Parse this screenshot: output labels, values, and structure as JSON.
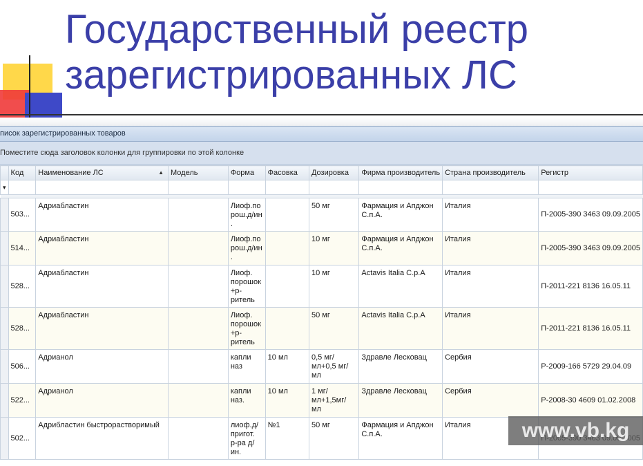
{
  "slide": {
    "title_line1": "Государственный реестр",
    "title_line2": "зарегистрированных ЛС"
  },
  "window": {
    "title": "писок зарегистрированных товаров",
    "group_hint": "Поместите сюда заголовок колонки для группировки по этой колонке"
  },
  "columns": [
    "Код",
    "Наименование ЛС",
    "Модель",
    "Форма",
    "Фасовка",
    "Дозировка",
    "Фирма производитель",
    "Страна производитель",
    "Регистр"
  ],
  "rows": [
    {
      "code": "503...",
      "name": "Адриабластин",
      "model": "",
      "form": "Лиоф.по рош.д/ин .",
      "pack": "",
      "dose": "50 мг",
      "maker": "Фармация и Апджон С.п.А.",
      "country": "Италия",
      "reg": "П-2005-390 3463 09.09.2005"
    },
    {
      "code": "514...",
      "name": "Адриабластин",
      "model": "",
      "form": "Лиоф.по рош.д/ин .",
      "pack": "",
      "dose": "10 мг",
      "maker": "Фармация и Апджон С.п.А.",
      "country": "Италия",
      "reg": "П-2005-390 3463 09.09.2005"
    },
    {
      "code": "528...",
      "name": "Адриабластин",
      "model": "",
      "form": "Лиоф. порошок +р-ритель",
      "pack": "",
      "dose": "10 мг",
      "maker": "Actavis Italia C.p.A",
      "country": "Италия",
      "reg": "П-2011-221 8136 16.05.11"
    },
    {
      "code": "528...",
      "name": "Адриабластин",
      "model": "",
      "form": "Лиоф. порошок +р-ритель",
      "pack": "",
      "dose": "50 мг",
      "maker": "Actavis Italia C.p.A",
      "country": "Италия",
      "reg": "П-2011-221 8136 16.05.11"
    },
    {
      "code": "506...",
      "name": "Адрианол",
      "model": "",
      "form": "капли наз",
      "pack": "10 мл",
      "dose": "0,5 мг/мл+0,5 мг/мл",
      "maker": "Здравле Лесковац",
      "country": "Сербия",
      "reg": "Р-2009-166 5729 29.04.09"
    },
    {
      "code": "522...",
      "name": "Адрианол",
      "model": "",
      "form": "капли наз.",
      "pack": "10 мл",
      "dose": "1 мг/мл+1,5мг/ мл",
      "maker": "Здравле Лесковац",
      "country": "Сербия",
      "reg": "Р-2008-30 4609 01.02.2008"
    },
    {
      "code": "502...",
      "name": "Адрибластин быстрорастворимый",
      "model": "",
      "form": "лиоф.д/ пригот. р-ра д/ин.",
      "pack": "№1",
      "dose": "50 мг",
      "maker": "Фармация и Апджон С.п.А.",
      "country": "Италия",
      "reg": "П-2005-390 3463 09.09.2005"
    }
  ],
  "watermark": "www.vb.kg",
  "colors": {
    "title": "#3b3fa8",
    "header_bg": "#e0e7f0",
    "group_panel": "#d6e0ee"
  }
}
